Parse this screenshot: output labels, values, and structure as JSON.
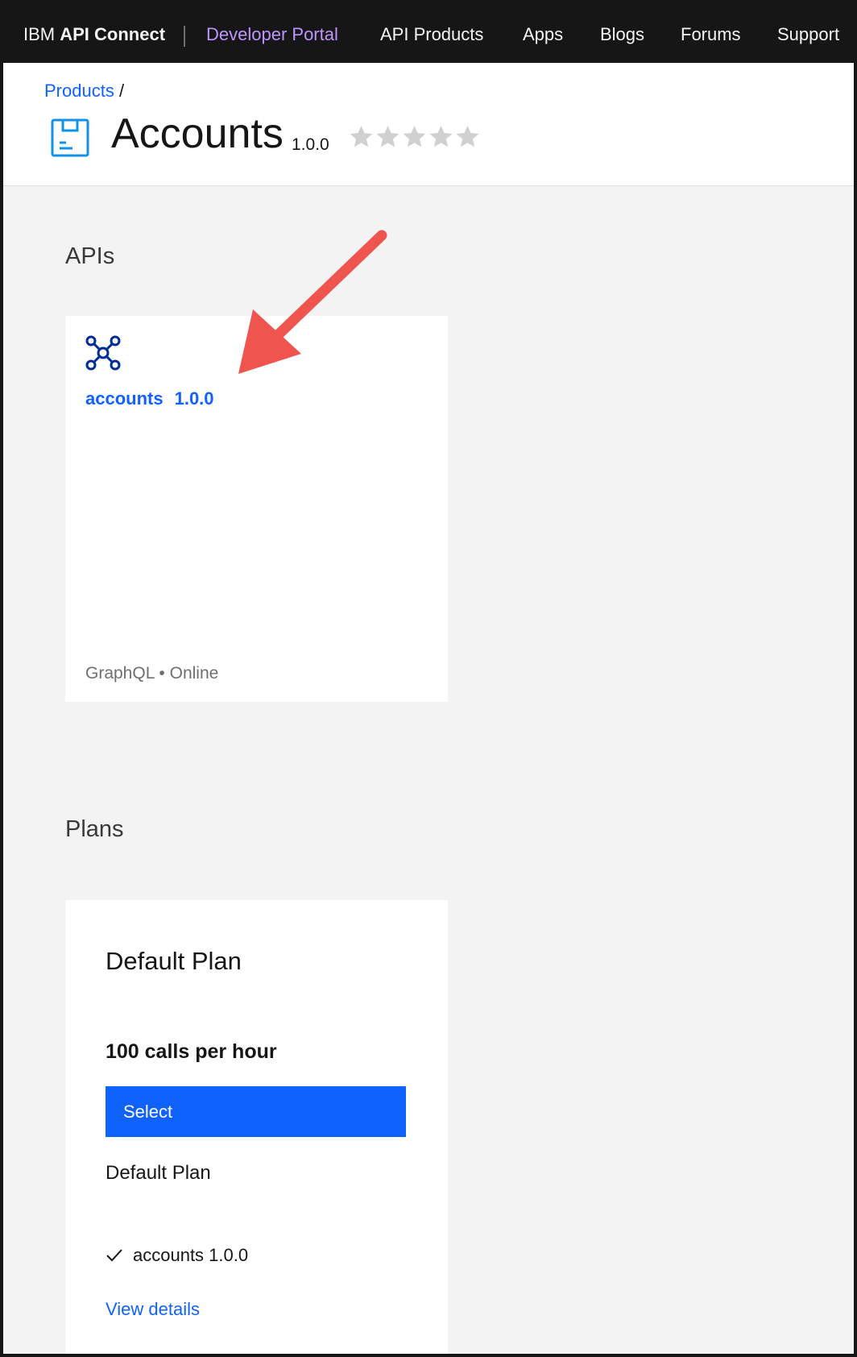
{
  "nav": {
    "brand_prefix": "IBM ",
    "brand_bold": "API Connect",
    "portal_label": "Developer Portal",
    "items": [
      {
        "label": "API Products"
      },
      {
        "label": "Apps"
      },
      {
        "label": "Blogs"
      },
      {
        "label": "Forums"
      },
      {
        "label": "Support"
      }
    ]
  },
  "breadcrumb": {
    "link": "Products",
    "separator": "/"
  },
  "product": {
    "title": "Accounts",
    "version": "1.0.0",
    "rating_stars": 5,
    "rating_value": 0
  },
  "apis_section": {
    "title": "APIs",
    "card": {
      "name": "accounts",
      "version": "1.0.0",
      "meta": "GraphQL • Online"
    }
  },
  "plans_section": {
    "title": "Plans",
    "card": {
      "title": "Default Plan",
      "rate": "100 calls per hour",
      "select_label": "Select",
      "description": "Default Plan",
      "api_item": "accounts 1.0.0",
      "view_details": "View details"
    }
  },
  "colors": {
    "accent": "#0f62fe",
    "portal_link": "#be95ff",
    "nav_bg": "#161616",
    "annotation_arrow": "#f0544f"
  }
}
